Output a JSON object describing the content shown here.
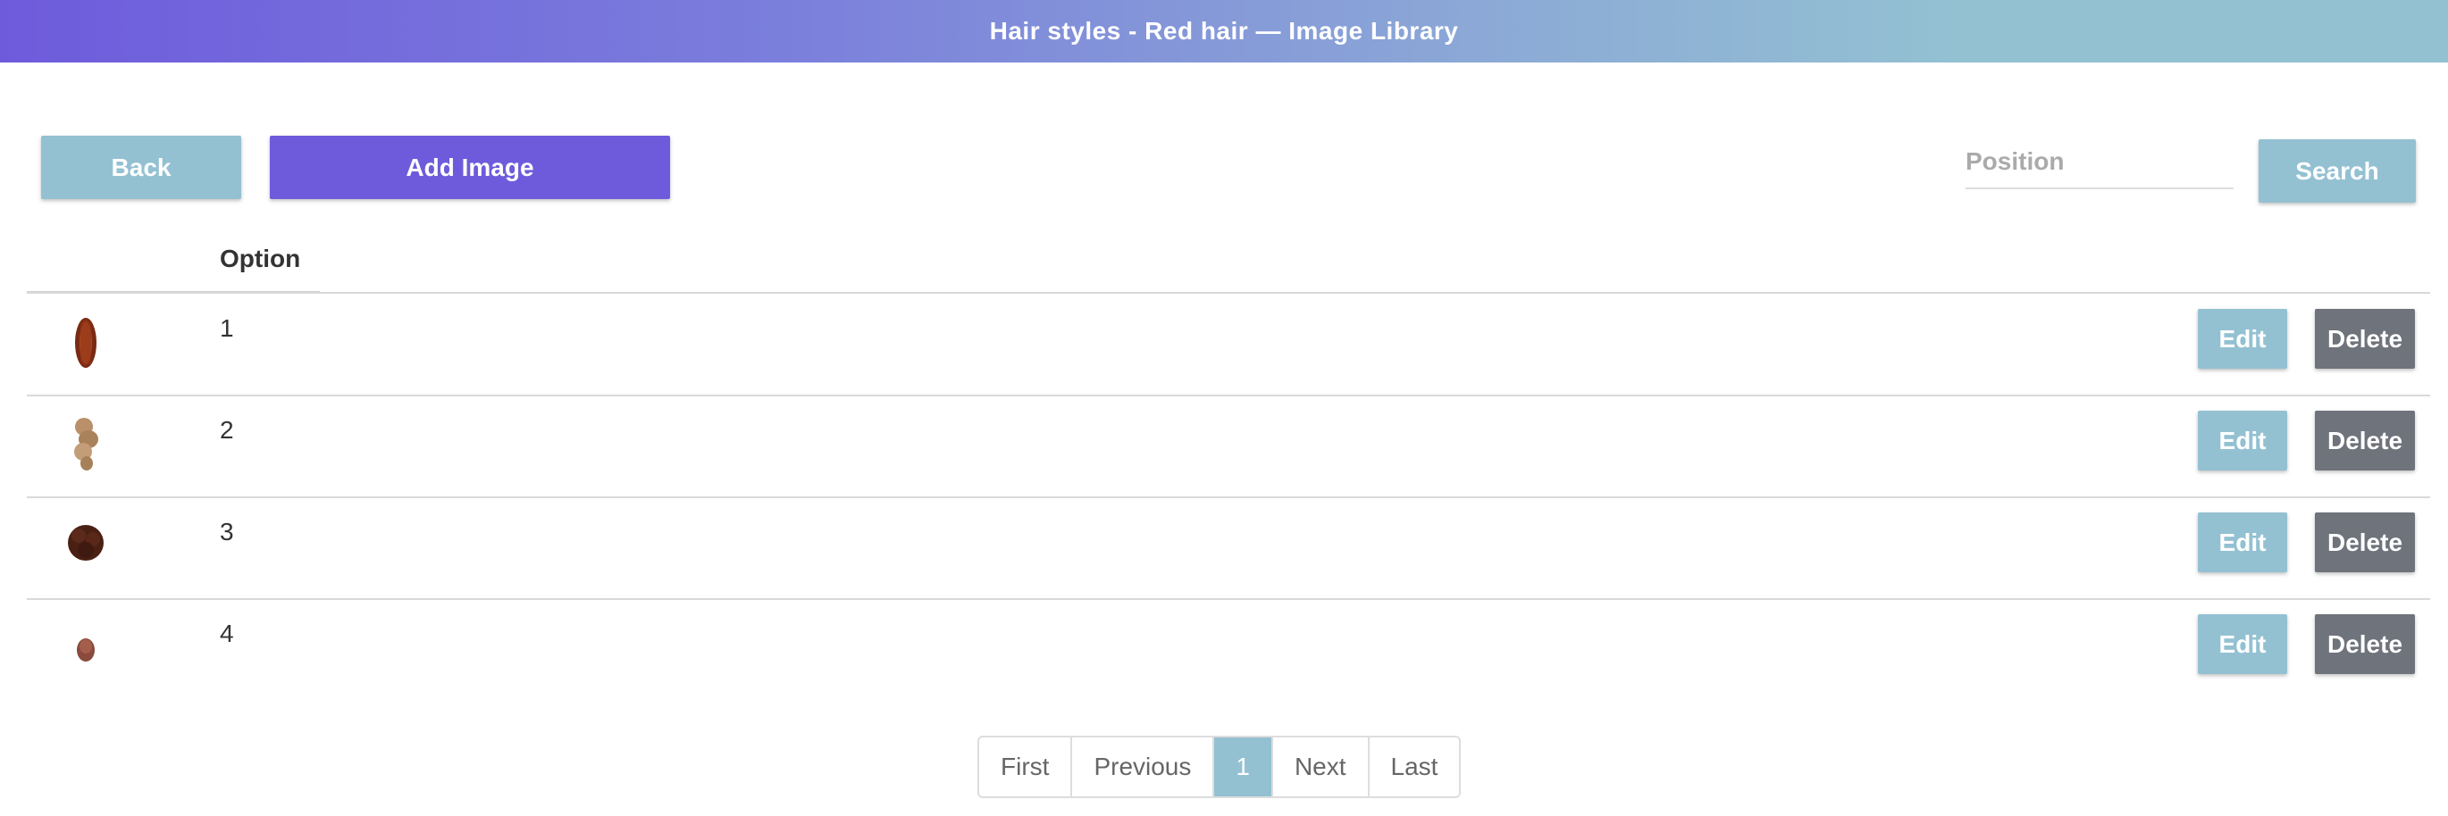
{
  "header": {
    "title": "Hair styles - Red hair — Image Library"
  },
  "toolbar": {
    "back_label": "Back",
    "add_label": "Add Image",
    "search_placeholder": "Position",
    "search_value": "",
    "search_label": "Search"
  },
  "table": {
    "column_header": "Option",
    "rows": [
      {
        "option": "1",
        "image_icon": "hair-long-straight-icon",
        "edit_label": "Edit",
        "delete_label": "Delete"
      },
      {
        "option": "2",
        "image_icon": "hair-curly-blonde-icon",
        "edit_label": "Edit",
        "delete_label": "Delete"
      },
      {
        "option": "3",
        "image_icon": "hair-afro-icon",
        "edit_label": "Edit",
        "delete_label": "Delete"
      },
      {
        "option": "4",
        "image_icon": "hair-short-icon",
        "edit_label": "Edit",
        "delete_label": "Delete"
      }
    ]
  },
  "pagination": {
    "first": "First",
    "previous": "Previous",
    "current": "1",
    "next": "Next",
    "last": "Last"
  },
  "colors": {
    "primary": "#6e5bdc",
    "secondary": "#93c1d2",
    "delete": "#6f737b"
  }
}
